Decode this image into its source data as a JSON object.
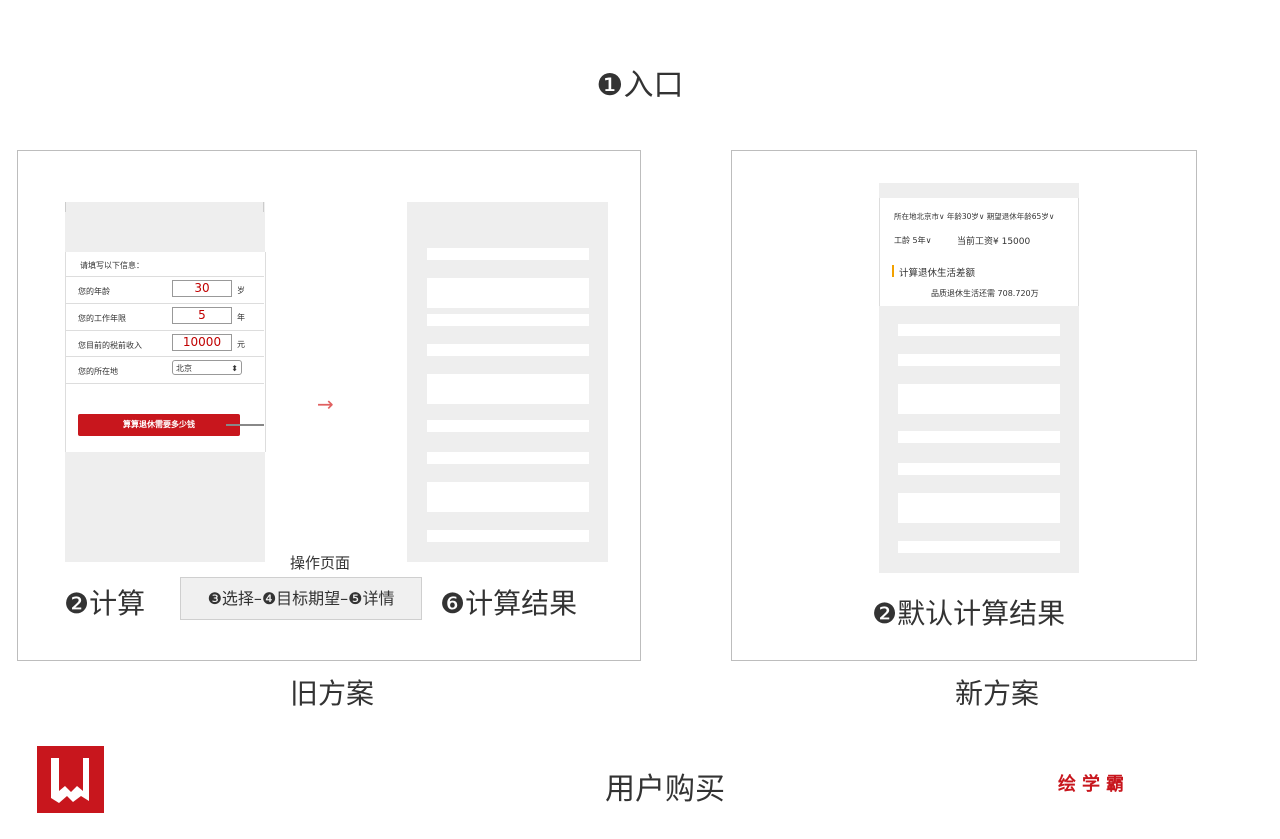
{
  "header": {
    "entry_title": "❶入口"
  },
  "old_plan": {
    "caption": "旧方案",
    "form": {
      "heading": "请填写以下信息：",
      "rows": [
        {
          "label": "您的年龄",
          "value": "30",
          "unit": "岁"
        },
        {
          "label": "您的工作年限",
          "value": "5",
          "unit": "年"
        },
        {
          "label": "您目前的税前收入",
          "value": "10000",
          "unit": "元"
        }
      ],
      "location": {
        "label": "您的所在地",
        "selected": "北京"
      },
      "button_label": "算算退休需要多少钱"
    },
    "arrow_glyph": "→",
    "ops_label": "操作页面",
    "step_calc": "❷计算",
    "ops_steps": "❸选择–❹目标期望–❺详情",
    "step_result": "❻计算结果"
  },
  "new_plan": {
    "caption": "新方案",
    "filters_row1": "所在地北京市∨  年龄30岁∨  期望退休年龄65岁∨",
    "filters_row2_left": "工龄 5年∨",
    "filters_row2_right": "当前工资¥ 15000",
    "section_title": "计算退休生活差额",
    "result_line": "品质退休生活还需 708.720万",
    "step_label": "❷默认计算结果"
  },
  "footer": {
    "title": "用户购买",
    "brand": "绘学霸"
  },
  "colors": {
    "accent_red": "#c8161d",
    "accent_yellow": "#f2a100",
    "placeholder_gray": "#eeeeee"
  }
}
